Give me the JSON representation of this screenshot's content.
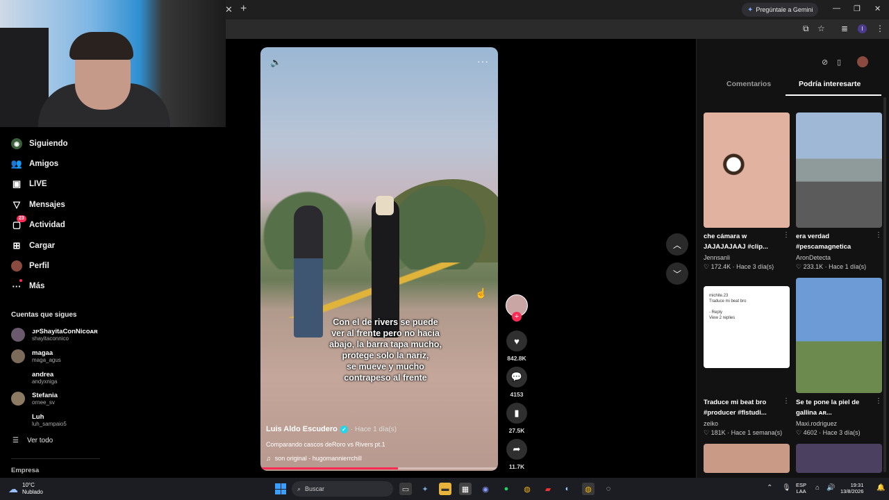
{
  "browser": {
    "gemini_label": "Pregúntale a Gemini",
    "profile_letter": "I"
  },
  "sidebar": {
    "items": [
      {
        "label": "Siguiendo",
        "icon": "following-avatar-icon"
      },
      {
        "label": "Amigos",
        "icon": "friends-icon"
      },
      {
        "label": "LIVE",
        "icon": "live-icon"
      },
      {
        "label": "Mensajes",
        "icon": "messages-icon"
      },
      {
        "label": "Actividad",
        "icon": "activity-icon",
        "badge": "23"
      },
      {
        "label": "Cargar",
        "icon": "upload-icon"
      },
      {
        "label": "Perfil",
        "icon": "profile-icon"
      },
      {
        "label": "Más",
        "icon": "more-icon"
      }
    ],
    "following_title": "Cuentas que sigues",
    "accounts": [
      {
        "name": "ᴊᴘShayitaConNicoᴀʀ",
        "handle": "shayitaconnico"
      },
      {
        "name": "magaa",
        "handle": "maga_agus"
      },
      {
        "name": "andrea",
        "handle": "andyxniga"
      },
      {
        "name": "Stefania",
        "handle": "ornee_sv"
      },
      {
        "name": "Luh",
        "handle": "luh_sampaio5"
      }
    ],
    "see_all": "Ver todo",
    "company": "Empresa"
  },
  "video": {
    "caption": "Con el de rivers se puede\nver al frente pero no hacia\nabajo, la barra tapa mucho,\nprotege solo la nariz,\nse mueve y mucho\ncontrapeso al frente",
    "author": "Luis Aldo Escudero",
    "time": "· Hace 1 día(s)",
    "description": "Comparando cascos deRoro vs Rivers pt.1",
    "sound": "son original - hugomannierrchill",
    "progress": 0.58
  },
  "actions": {
    "likes": "842.8K",
    "comments": "4153",
    "saves": "27.5K",
    "shares": "11.7K"
  },
  "right_panel": {
    "tabs": [
      "Comentarios",
      "Podría interesarte"
    ],
    "active_tab": 1,
    "cards": [
      {
        "title": "che cámara w JAJAJAJAAJ #clip...",
        "author": "Jennsanli",
        "likes": "172.4K",
        "time": "Hace 3 día(s)"
      },
      {
        "title": "era verdad #pescamagnetica",
        "author": "AronDetecta",
        "likes": "233.1K",
        "time": "Hace 1 día(s)"
      },
      {
        "title": "Traduce mi beat bro #producer #flstudi...",
        "author": "zeiko",
        "likes": "181K",
        "time": "Hace 1 semana(s)"
      },
      {
        "title": "Se te pone la piel de gallina ᴀʀ...",
        "author": "Maxi.rodriguez",
        "likes": "4602",
        "time": "Hace 3 día(s)"
      }
    ],
    "doc_lines": "michite.23\nTraduce mi beat bro\n\n- Reply\nView 2 replies"
  },
  "taskbar": {
    "temp": "10°C",
    "weather": "Nublado",
    "search_placeholder": "Buscar",
    "lang_top": "ESP",
    "lang_bottom": "LAA",
    "time": "19:31",
    "date": "13/8/2026"
  }
}
